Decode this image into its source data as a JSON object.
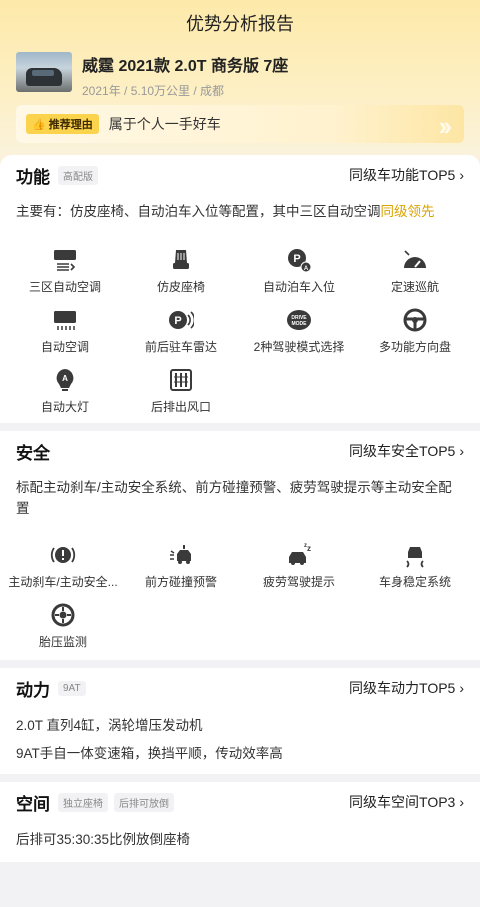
{
  "header": {
    "title": "优势分析报告"
  },
  "car": {
    "name": "威霆 2021款 2.0T 商务版 7座",
    "meta": "2021年 / 5.10万公里 / 成都"
  },
  "reason": {
    "badge": "推荐理由",
    "text": "属于个人一手好车"
  },
  "function": {
    "title": "功能",
    "tag": "高配版",
    "top5": "同级车功能TOP5",
    "desc_main": "主要有：仿皮座椅、自动泊车入位等配置，其中三区自动空调",
    "desc_hl": "同级领先",
    "items": [
      {
        "label": "三区自动空调",
        "icon": "ac-three-zone-icon"
      },
      {
        "label": "仿皮座椅",
        "icon": "seat-icon"
      },
      {
        "label": "自动泊车入位",
        "icon": "auto-park-icon"
      },
      {
        "label": "定速巡航",
        "icon": "cruise-icon"
      },
      {
        "label": "自动空调",
        "icon": "ac-icon"
      },
      {
        "label": "前后驻车雷达",
        "icon": "parking-radar-icon"
      },
      {
        "label": "2种驾驶模式选择",
        "icon": "drive-mode-icon"
      },
      {
        "label": "多功能方向盘",
        "icon": "steering-wheel-icon"
      },
      {
        "label": "自动大灯",
        "icon": "auto-headlight-icon"
      },
      {
        "label": "后排出风口",
        "icon": "rear-vent-icon"
      }
    ]
  },
  "safety": {
    "title": "安全",
    "top5": "同级车安全TOP5",
    "desc": "标配主动刹车/主动安全系统、前方碰撞预警、疲劳驾驶提示等主动安全配置",
    "items": [
      {
        "label": "主动刹车/主动安全...",
        "icon": "brake-icon"
      },
      {
        "label": "前方碰撞预警",
        "icon": "collision-warning-icon"
      },
      {
        "label": "疲劳驾驶提示",
        "icon": "fatigue-icon"
      },
      {
        "label": "车身稳定系统",
        "icon": "stability-icon"
      },
      {
        "label": "胎压监测",
        "icon": "tire-pressure-icon"
      }
    ]
  },
  "power": {
    "title": "动力",
    "tag": "9AT",
    "top5": "同级车动力TOP5",
    "lines": [
      "2.0T 直列4缸，涡轮增压发动机",
      "9AT手自一体变速箱，换挡平顺，传动效率高"
    ]
  },
  "space": {
    "title": "空间",
    "tags": [
      "独立座椅",
      "后排可放倒"
    ],
    "top5": "同级车空间TOP3",
    "line": "后排可35:30:35比例放倒座椅"
  },
  "colors": {
    "accent": "#d9a300",
    "badge": "#fcd34d",
    "icon": "#3a3a3a"
  }
}
